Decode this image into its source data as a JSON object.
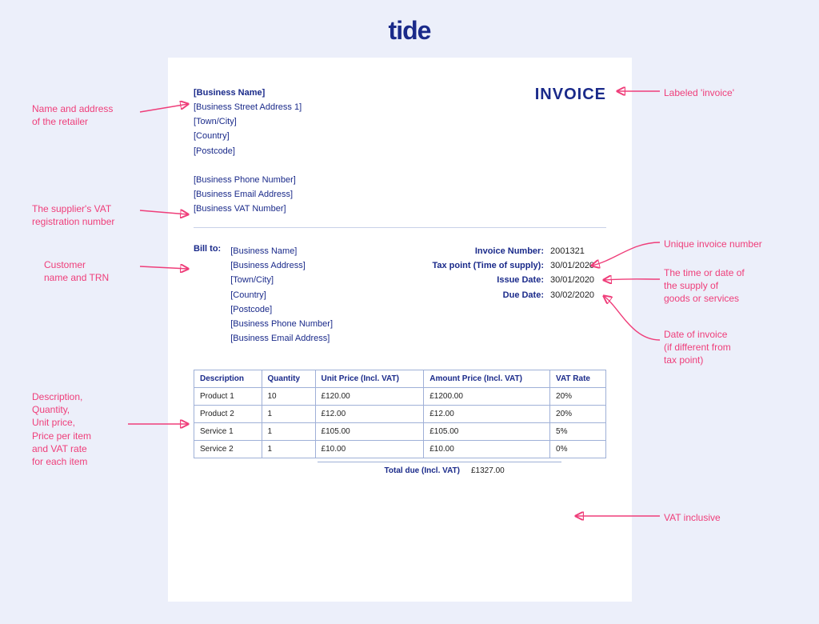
{
  "brand": "tide",
  "invoice_label": "INVOICE",
  "sender": {
    "name": "[Business Name]",
    "street": "[Business Street Address 1]",
    "town": "[Town/City]",
    "country": "[Country]",
    "postcode": "[Postcode]",
    "phone": "[Business Phone Number]",
    "email": "[Business Email Address]",
    "vat": "[Business VAT Number]"
  },
  "billto": {
    "label": "Bill to:",
    "name": "[Business Name]",
    "address": "[Business Address]",
    "town": "[Town/City]",
    "country": "[Country]",
    "postcode": "[Postcode]",
    "phone": "[Business Phone Number]",
    "email": "[Business Email Address]"
  },
  "meta": {
    "invoice_number_label": "Invoice Number:",
    "invoice_number": "2001321",
    "tax_point_label": "Tax point (Time of supply):",
    "tax_point": "30/01/2020",
    "issue_date_label": "Issue Date:",
    "issue_date": "30/01/2020",
    "due_date_label": "Due Date:",
    "due_date": "30/02/2020"
  },
  "table": {
    "headers": {
      "description": "Description",
      "quantity": "Quantity",
      "unit_price": "Unit Price (Incl. VAT)",
      "amount": "Amount Price (Incl. VAT)",
      "vat_rate": "VAT Rate"
    },
    "rows": [
      {
        "description": "Product 1",
        "quantity": "10",
        "unit_price": "£120.00",
        "amount": "£1200.00",
        "vat_rate": "20%"
      },
      {
        "description": "Product 2",
        "quantity": "1",
        "unit_price": "£12.00",
        "amount": "£12.00",
        "vat_rate": "20%"
      },
      {
        "description": "Service 1",
        "quantity": "1",
        "unit_price": "£105.00",
        "amount": "£105.00",
        "vat_rate": "5%"
      },
      {
        "description": "Service 2",
        "quantity": "1",
        "unit_price": "£10.00",
        "amount": "£10.00",
        "vat_rate": "0%"
      }
    ],
    "total_label": "Total due (Incl. VAT)",
    "total_value": "£1327.00"
  },
  "annotations": {
    "retailer": "Name and address\nof the retailer",
    "supplier_vat": "The supplier's VAT\nregistration number",
    "customer": "Customer\nname and TRN",
    "line_items": "Description,\nQuantity,\nUnit price,\nPrice per item\nand VAT rate\nfor each item",
    "labeled_invoice": "Labeled 'invoice'",
    "unique_number": "Unique invoice number",
    "supply_time": "The time or date of\nthe supply of\ngoods or services",
    "issue_date_note": "Date of invoice\n(if different from\ntax point)",
    "vat_inclusive": "VAT inclusive"
  }
}
